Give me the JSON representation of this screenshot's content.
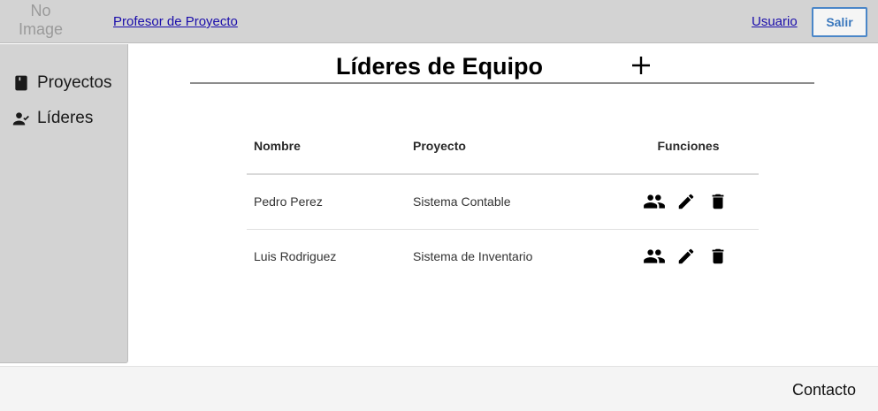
{
  "header": {
    "logo_line1": "No",
    "logo_line2": "Image",
    "role_link": "Profesor de Proyecto",
    "user_link": "Usuario",
    "logout_label": "Salir"
  },
  "sidebar": {
    "items": [
      {
        "label": "Proyectos",
        "icon": "book-icon"
      },
      {
        "label": "Líderes",
        "icon": "person-check-icon"
      }
    ]
  },
  "main": {
    "title": "Líderes de Equipo",
    "add_icon": "plus-icon",
    "table": {
      "headers": [
        "Nombre",
        "Proyecto",
        "Funciones"
      ],
      "rows": [
        {
          "nombre": "Pedro Perez",
          "proyecto": "Sistema Contable"
        },
        {
          "nombre": "Luis Rodriguez",
          "proyecto": "Sistema de Inventario"
        }
      ],
      "action_icons": [
        "group-icon",
        "pencil-icon",
        "trash-icon"
      ]
    }
  },
  "footer": {
    "contact": "Contacto"
  },
  "colors": {
    "bar_gray": "#d3d3d3",
    "link_blue": "#1a0dab",
    "button_blue": "#3b78bd"
  }
}
